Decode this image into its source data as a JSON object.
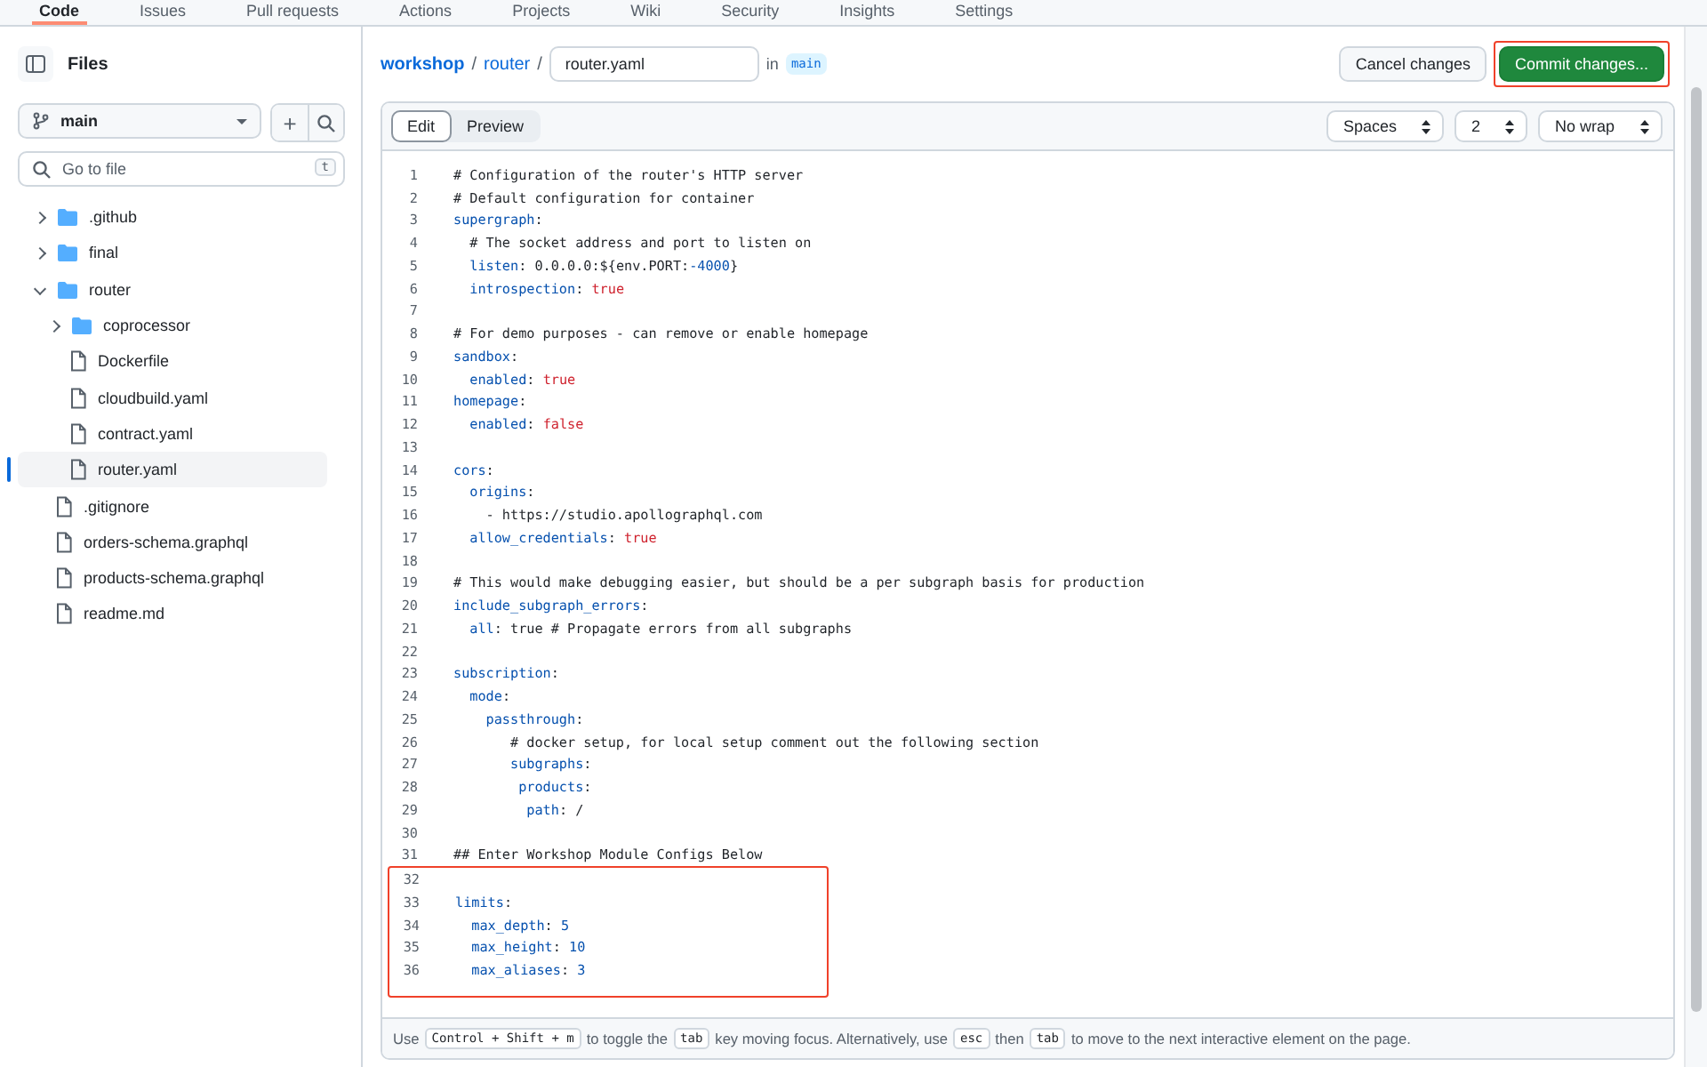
{
  "repo_tabs": [
    {
      "label": "Code",
      "selected": true
    },
    {
      "label": "Issues",
      "selected": false
    },
    {
      "label": "Pull requests",
      "selected": false
    },
    {
      "label": "Actions",
      "selected": false
    },
    {
      "label": "Projects",
      "selected": false
    },
    {
      "label": "Wiki",
      "selected": false
    },
    {
      "label": "Security",
      "selected": false
    },
    {
      "label": "Insights",
      "selected": false
    },
    {
      "label": "Settings",
      "selected": false
    }
  ],
  "sidebar": {
    "title": "Files",
    "branch": "main",
    "add": "+",
    "search_placeholder": "Go to file",
    "search_shortcut": "t",
    "tree": [
      {
        "name": ".github",
        "kind": "folder",
        "expanded": false,
        "selected": false
      },
      {
        "name": "final",
        "kind": "folder",
        "expanded": false,
        "selected": false
      },
      {
        "name": "router",
        "kind": "folder",
        "expanded": true,
        "selected": false,
        "children": [
          {
            "name": "coprocessor",
            "kind": "folder",
            "expanded": false,
            "selected": false
          },
          {
            "name": "Dockerfile",
            "kind": "file",
            "selected": false
          },
          {
            "name": "cloudbuild.yaml",
            "kind": "file",
            "selected": false
          },
          {
            "name": "contract.yaml",
            "kind": "file",
            "selected": false
          },
          {
            "name": "router.yaml",
            "kind": "file",
            "selected": true
          }
        ]
      },
      {
        "name": ".gitignore",
        "kind": "file",
        "selected": false
      },
      {
        "name": "orders-schema.graphql",
        "kind": "file",
        "selected": false
      },
      {
        "name": "products-schema.graphql",
        "kind": "file",
        "selected": false
      },
      {
        "name": "readme.md",
        "kind": "file",
        "selected": false
      }
    ]
  },
  "breadcrumb": {
    "parts": [
      "workshop",
      "router"
    ],
    "separator": "/",
    "filename": "router.yaml",
    "in": "in",
    "branch": "main"
  },
  "buttons": [
    {
      "label": "Cancel changes",
      "kind": "secondary",
      "outlined": false
    },
    {
      "label": "Commit changes...",
      "kind": "primary",
      "outlined": true
    }
  ],
  "editor": {
    "modes": [
      {
        "label": "Edit",
        "selected": true
      },
      {
        "label": "Preview",
        "selected": false
      }
    ],
    "selects": [
      "Spaces",
      "2",
      "No wrap"
    ],
    "lines": [
      {
        "n": "1",
        "tokens": [
          {
            "kind": "comment",
            "text": "# Configuration of the router's HTTP server"
          }
        ]
      },
      {
        "n": "2",
        "tokens": [
          {
            "kind": "comment",
            "text": "# Default configuration for container"
          }
        ]
      },
      {
        "n": "3",
        "tokens": [
          {
            "kind": "key",
            "text": "supergraph"
          },
          {
            "kind": "plain",
            "text": ":"
          }
        ]
      },
      {
        "n": "4",
        "tokens": [
          {
            "kind": "comment",
            "text": "  # The socket address and port to listen on"
          }
        ]
      },
      {
        "n": "5",
        "tokens": [
          {
            "kind": "key",
            "text": "  listen"
          },
          {
            "kind": "plain",
            "text": ": 0.0.0.0:${env.PORT:"
          },
          {
            "kind": "number",
            "text": "-4000"
          },
          {
            "kind": "plain",
            "text": "}"
          }
        ]
      },
      {
        "n": "6",
        "tokens": [
          {
            "kind": "key",
            "text": "  introspection"
          },
          {
            "kind": "plain",
            "text": ": "
          },
          {
            "kind": "bool",
            "text": "true"
          }
        ]
      },
      {
        "n": "7"
      },
      {
        "n": "8",
        "tokens": [
          {
            "kind": "comment",
            "text": "# For demo purposes - can remove or enable homepage"
          }
        ]
      },
      {
        "n": "9",
        "tokens": [
          {
            "kind": "key",
            "text": "sandbox"
          },
          {
            "kind": "plain",
            "text": ":"
          }
        ]
      },
      {
        "n": "10",
        "tokens": [
          {
            "kind": "key",
            "text": "  enabled"
          },
          {
            "kind": "plain",
            "text": ": "
          },
          {
            "kind": "bool",
            "text": "true"
          }
        ]
      },
      {
        "n": "11",
        "tokens": [
          {
            "kind": "key",
            "text": "homepage"
          },
          {
            "kind": "plain",
            "text": ":"
          }
        ]
      },
      {
        "n": "12",
        "tokens": [
          {
            "kind": "key",
            "text": "  enabled"
          },
          {
            "kind": "plain",
            "text": ": "
          },
          {
            "kind": "bool",
            "text": "false"
          }
        ]
      },
      {
        "n": "13"
      },
      {
        "n": "14",
        "tokens": [
          {
            "kind": "key",
            "text": "cors"
          },
          {
            "kind": "plain",
            "text": ":"
          }
        ]
      },
      {
        "n": "15",
        "tokens": [
          {
            "kind": "key",
            "text": "  origins"
          },
          {
            "kind": "plain",
            "text": ":"
          }
        ]
      },
      {
        "n": "16",
        "tokens": [
          {
            "kind": "plain",
            "text": "    - https://studio.apollographql.com"
          }
        ]
      },
      {
        "n": "17",
        "tokens": [
          {
            "kind": "key",
            "text": "  allow_credentials"
          },
          {
            "kind": "plain",
            "text": ": "
          },
          {
            "kind": "bool",
            "text": "true"
          }
        ]
      },
      {
        "n": "18"
      },
      {
        "n": "19",
        "tokens": [
          {
            "kind": "comment",
            "text": "# This would make debugging easier, but should be a per subgraph basis for production"
          }
        ]
      },
      {
        "n": "20",
        "tokens": [
          {
            "kind": "key",
            "text": "include_subgraph_errors"
          },
          {
            "kind": "plain",
            "text": ":"
          }
        ]
      },
      {
        "n": "21",
        "tokens": [
          {
            "kind": "key",
            "text": "  all"
          },
          {
            "kind": "plain",
            "text": ": true # Propagate errors from all subgraphs"
          }
        ]
      },
      {
        "n": "22"
      },
      {
        "n": "23",
        "tokens": [
          {
            "kind": "key",
            "text": "subscription"
          },
          {
            "kind": "plain",
            "text": ":"
          }
        ]
      },
      {
        "n": "24",
        "tokens": [
          {
            "kind": "key",
            "text": "  mode"
          },
          {
            "kind": "plain",
            "text": ":"
          }
        ]
      },
      {
        "n": "25",
        "tokens": [
          {
            "kind": "key",
            "text": "    passthrough"
          },
          {
            "kind": "plain",
            "text": ":"
          }
        ]
      },
      {
        "n": "26",
        "tokens": [
          {
            "kind": "comment",
            "text": "       # docker setup, for local setup comment out the following section"
          }
        ]
      },
      {
        "n": "27",
        "tokens": [
          {
            "kind": "key",
            "text": "       subgraphs"
          },
          {
            "kind": "plain",
            "text": ":"
          }
        ]
      },
      {
        "n": "28",
        "tokens": [
          {
            "kind": "key",
            "text": "        products"
          },
          {
            "kind": "plain",
            "text": ":"
          }
        ]
      },
      {
        "n": "29",
        "tokens": [
          {
            "kind": "key",
            "text": "         path"
          },
          {
            "kind": "plain",
            "text": ": /"
          }
        ]
      },
      {
        "n": "30"
      },
      {
        "n": "31",
        "tokens": [
          {
            "kind": "comment",
            "text": "## Enter Workshop Module Configs Below"
          }
        ]
      }
    ],
    "highlighted_lines": [
      {
        "n": "32"
      },
      {
        "n": "33",
        "tokens": [
          {
            "kind": "key",
            "text": "limits"
          },
          {
            "kind": "plain",
            "text": ":"
          }
        ]
      },
      {
        "n": "34",
        "tokens": [
          {
            "kind": "key",
            "text": "  max_depth"
          },
          {
            "kind": "plain",
            "text": ": "
          },
          {
            "kind": "number",
            "text": "5"
          }
        ]
      },
      {
        "n": "35",
        "tokens": [
          {
            "kind": "key",
            "text": "  max_height"
          },
          {
            "kind": "plain",
            "text": ": "
          },
          {
            "kind": "number",
            "text": "10"
          }
        ]
      },
      {
        "n": "36",
        "tokens": [
          {
            "kind": "key",
            "text": "  max_aliases"
          },
          {
            "kind": "plain",
            "text": ": "
          },
          {
            "kind": "number",
            "text": "3"
          }
        ]
      }
    ],
    "footer": [
      {
        "kind": "text",
        "text": "Use"
      },
      {
        "kind": "key",
        "text": "Control + Shift + m"
      },
      {
        "kind": "text",
        "text": "to toggle the"
      },
      {
        "kind": "key",
        "text": "tab"
      },
      {
        "kind": "text",
        "text": "key moving focus. Alternatively, use"
      },
      {
        "kind": "key",
        "text": "esc"
      },
      {
        "kind": "text",
        "text": "then"
      },
      {
        "kind": "key",
        "text": "tab"
      },
      {
        "kind": "text",
        "text": "to move to the next interactive element on the page."
      }
    ]
  }
}
